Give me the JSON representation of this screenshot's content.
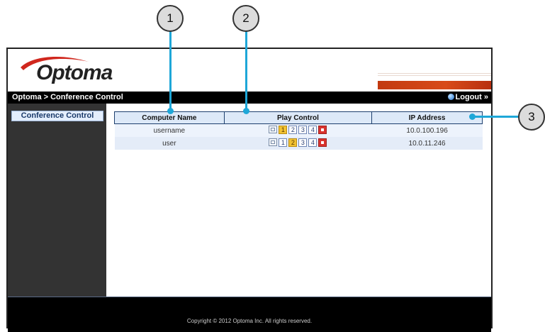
{
  "header": {
    "logo": "Optoma",
    "breadcrumb": "Optoma > Conference Control",
    "logout_label": "Logout",
    "logout_arrow": "»"
  },
  "sidebar": {
    "items": [
      {
        "label": "Conference Control"
      }
    ]
  },
  "table": {
    "columns": [
      "Computer Name",
      "Play Control",
      "IP Address"
    ],
    "rows": [
      {
        "computer": "username",
        "ip": "10.0.100.196",
        "active": 1
      },
      {
        "computer": "user",
        "ip": "10.0.11.246",
        "active": 2
      }
    ],
    "split_numbers": [
      "1",
      "2",
      "3",
      "4"
    ]
  },
  "footer": {
    "copyright": "Copyright © 2012 Optoma Inc. All rights reserved."
  },
  "callouts": [
    "1",
    "2",
    "3"
  ],
  "colors": {
    "accent": "#1ea7d8",
    "brand_red": "#d84a18",
    "active_split": "#f1c232"
  }
}
